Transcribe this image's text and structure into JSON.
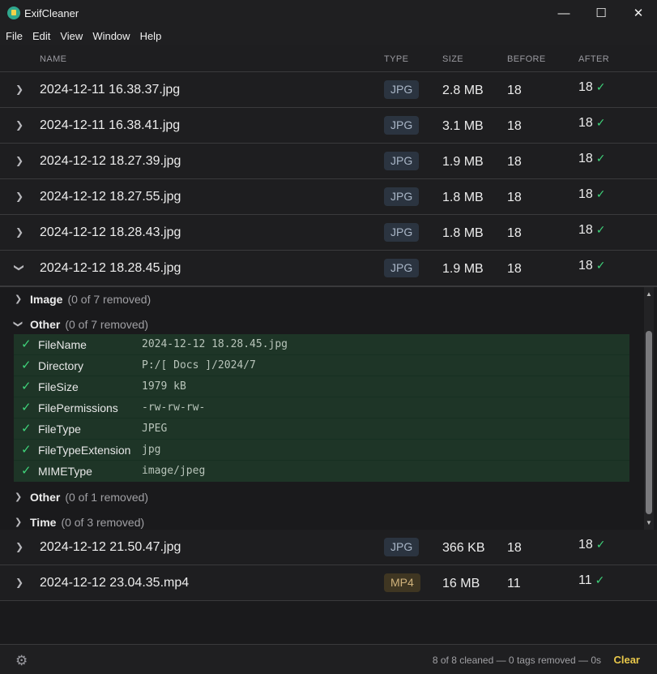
{
  "window": {
    "title": "ExifCleaner",
    "minimize": "—",
    "maximize": "☐",
    "close": "✕"
  },
  "menu": [
    "File",
    "Edit",
    "View",
    "Window",
    "Help"
  ],
  "columns": {
    "name": "NAME",
    "type": "TYPE",
    "size": "SIZE",
    "before": "BEFORE",
    "after": "AFTER"
  },
  "files": [
    {
      "name": "2024-12-11 16.38.37.jpg",
      "type": "JPG",
      "size": "2.8 MB",
      "before": "18",
      "after": "18"
    },
    {
      "name": "2024-12-11 16.38.41.jpg",
      "type": "JPG",
      "size": "3.1 MB",
      "before": "18",
      "after": "18"
    },
    {
      "name": "2024-12-12 18.27.39.jpg",
      "type": "JPG",
      "size": "1.9 MB",
      "before": "18",
      "after": "18"
    },
    {
      "name": "2024-12-12 18.27.55.jpg",
      "type": "JPG",
      "size": "1.8 MB",
      "before": "18",
      "after": "18"
    },
    {
      "name": "2024-12-12 18.28.43.jpg",
      "type": "JPG",
      "size": "1.8 MB",
      "before": "18",
      "after": "18"
    },
    {
      "name": "2024-12-12 18.28.45.jpg",
      "type": "JPG",
      "size": "1.9 MB",
      "before": "18",
      "after": "18"
    },
    {
      "name": "2024-12-12 21.50.47.jpg",
      "type": "JPG",
      "size": "366 KB",
      "before": "18",
      "after": "18"
    },
    {
      "name": "2024-12-12 23.04.35.mp4",
      "type": "MP4",
      "size": "16 MB",
      "before": "11",
      "after": "11"
    }
  ],
  "details": {
    "groups": [
      {
        "name": "Image",
        "count": "(0 of 7 removed)"
      },
      {
        "name": "Other",
        "count": "(0 of 7 removed)"
      },
      {
        "name": "Other",
        "count": "(0 of 1 removed)"
      },
      {
        "name": "Time",
        "count": "(0 of 3 removed)"
      }
    ],
    "tags": [
      {
        "name": "FileName",
        "value": "2024-12-12 18.28.45.jpg"
      },
      {
        "name": "Directory",
        "value": "P:/[ Docs ]/2024/7"
      },
      {
        "name": "FileSize",
        "value": "1979 kB"
      },
      {
        "name": "FilePermissions",
        "value": "-rw-rw-rw-"
      },
      {
        "name": "FileType",
        "value": "JPEG"
      },
      {
        "name": "FileTypeExtension",
        "value": "jpg"
      },
      {
        "name": "MIMEType",
        "value": "image/jpeg"
      }
    ]
  },
  "footer": {
    "status": "8 of 8 cleaned — 0 tags removed — 0s",
    "clear": "Clear"
  },
  "colors": {
    "accent_check": "#3fd37a",
    "clear": "#e9c84a",
    "tag_bg": "#1e3527"
  },
  "icons": {
    "check": "check-icon",
    "chevron_right": "chevron-right-icon",
    "chevron_down": "chevron-down-icon",
    "gear": "gear-icon"
  }
}
